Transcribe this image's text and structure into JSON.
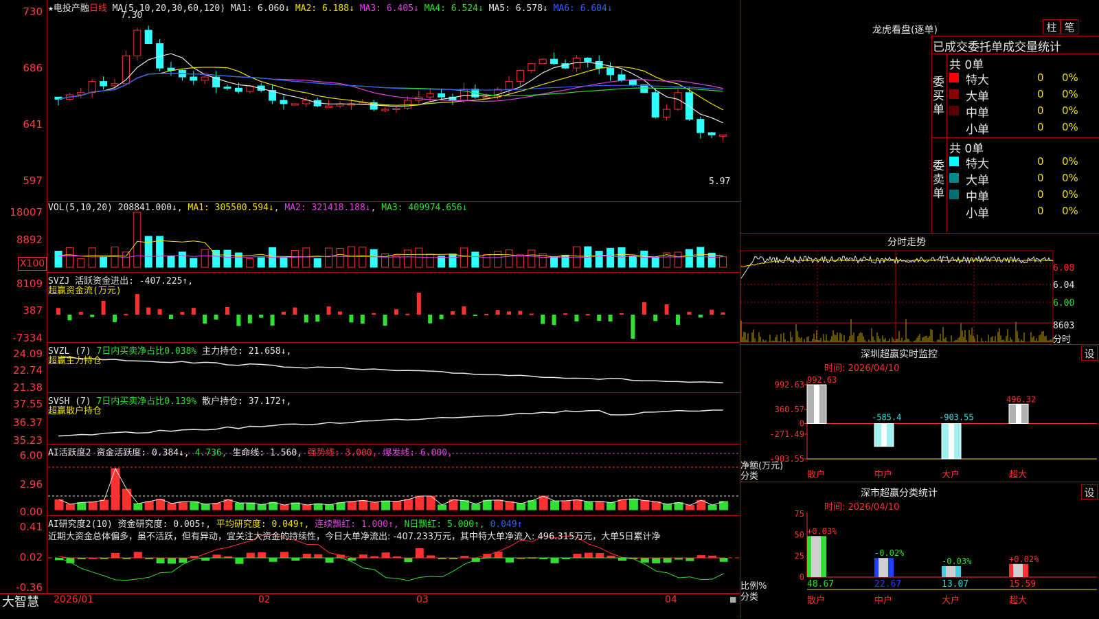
{
  "app": {
    "brand": "大智慧"
  },
  "kline": {
    "title": "★电投产融",
    "period": "日线",
    "ma_params": "MA(5,10,20,30,60,120)",
    "ma": [
      {
        "name": "MA1",
        "value": "6.060↓",
        "color": "#e6e6e6"
      },
      {
        "name": "MA2",
        "value": "6.188↓",
        "color": "#f0e000"
      },
      {
        "name": "MA3",
        "value": "6.405↓",
        "color": "#e040e0"
      },
      {
        "name": "MA4",
        "value": "6.524↓",
        "color": "#30e030"
      },
      {
        "name": "MA5",
        "value": "6.578↓",
        "color": "#e6e6e6"
      },
      {
        "name": "MA6",
        "value": "6.604↓",
        "color": "#3060ff"
      }
    ],
    "y_ticks": [
      "730",
      "686",
      "641",
      "597"
    ],
    "high_label": "7.30",
    "low_label": "5.97"
  },
  "vol": {
    "header": "VOL(5,10,20)",
    "value": "208841.000↓",
    "ma1": "MA1: 305500.594↓",
    "ma2": "MA2: 321418.188↓",
    "ma3": "MA3: 409974.656↓",
    "y_ticks": [
      "18007",
      "8892"
    ],
    "unit": "X100"
  },
  "svzj": {
    "header": "SVZJ",
    "item": "活跃资金进出: -407.225↑,",
    "subtitle": "超赢资金流(万元)",
    "y_ticks": [
      "8109",
      "387",
      "-7334"
    ]
  },
  "svzl": {
    "header": "SVZL (7)",
    "item1": "7日内买卖净占比0.038%",
    "item2": "主力持仓: 21.658↓,",
    "subtitle": "超赢主力持仓",
    "y_ticks": [
      "24.09",
      "22.74",
      "21.38"
    ]
  },
  "svsh": {
    "header": "SVSH (7)",
    "item1": "7日内买卖净占比0.139%",
    "item2": "散户持仓: 37.172↑,",
    "subtitle": "超赢散户持仓",
    "y_ticks": [
      "37.55",
      "36.37",
      "35.23"
    ]
  },
  "ai1": {
    "header": "AI活跃度2",
    "item1": "资金活跃度: 0.384↓,",
    "item2": "4.736,",
    "item3": "生命线: 1.560,",
    "item4": "强势线: 3.000,",
    "item5": "爆发线: 6.000,",
    "y_ticks": [
      "6.00",
      "2.96",
      "0.00"
    ]
  },
  "ai2": {
    "header": "AI研究度2(10)",
    "item1": "资金研究度: 0.005↑,",
    "item2": "平均研究度: 0.049↑,",
    "item3": "连续飘红: 1.000↑,",
    "item4": "N日飘红: 5.000↑,",
    "item5": "0.049↑",
    "comment": "近期大资金总体偏多，虽不活跃，但有异动，宜关注大资金的持续性，今日大单净流出: -407.233万元，其中特大单净流入: 496.315万元，大单5日累计净",
    "y_ticks": [
      "0.41",
      "0.02",
      "-0.36"
    ]
  },
  "xaxis": {
    "labels": [
      "2026/01",
      "02",
      "03",
      "04"
    ]
  },
  "lhb": {
    "title": "龙虎看盘(逐单)",
    "tab1": "柱",
    "tab2": "笔",
    "subtitle": "已成交委托单成交量统计",
    "buy": {
      "side": "委买单",
      "total": "共 0单",
      "rows": [
        {
          "label": "特大",
          "value": "0",
          "pct": "0%",
          "color": "#ff0000"
        },
        {
          "label": "大单",
          "value": "0",
          "pct": "0%",
          "color": "#8b0000"
        },
        {
          "label": "中单",
          "value": "0",
          "pct": "0%",
          "color": "#5a0000"
        },
        {
          "label": "小单",
          "value": "0",
          "pct": "0%",
          "color": "#000000"
        }
      ]
    },
    "sell": {
      "side": "委卖单",
      "total": "共 0单",
      "rows": [
        {
          "label": "特大",
          "value": "0",
          "pct": "0%",
          "color": "#00ffff"
        },
        {
          "label": "大单",
          "value": "0",
          "pct": "0%",
          "color": "#008b8b"
        },
        {
          "label": "中单",
          "value": "0",
          "pct": "0%",
          "color": "#007070"
        },
        {
          "label": "小单",
          "value": "0",
          "pct": "0%",
          "color": "#000000"
        }
      ]
    }
  },
  "intraday": {
    "title": "分时走势",
    "y_ticks": [
      "6.08",
      "6.04",
      "6.00"
    ],
    "vol_tick": "8603",
    "vol_label": "分时"
  },
  "sz_monitor": {
    "title": "深圳超赢实时监控",
    "settings": "设",
    "time": "时间: 2026/04/10",
    "y_ticks": [
      "992.63",
      "360.57",
      "0",
      "-271.49",
      "-903.55"
    ],
    "ylabel1": "净额(万元)",
    "ylabel2": "分类",
    "chart_data": {
      "type": "bar",
      "categories": [
        "散户",
        "中户",
        "大户",
        "超大"
      ],
      "values": [
        992.63,
        -585.4,
        -903.55,
        496.32
      ],
      "labels": [
        "992.63",
        "-585.4",
        "-903.55",
        "496.32"
      ],
      "ylim": [
        -903.55,
        992.63
      ]
    }
  },
  "sz_class": {
    "title": "深市超赢分类统计",
    "settings": "设",
    "time": "时间: 2026/04/10",
    "y_ticks": [
      "75",
      "50",
      "25",
      "0"
    ],
    "ylabel1": "比例%",
    "ylabel2": "分类",
    "chart_data": {
      "type": "bar",
      "categories": [
        "散户",
        "中户",
        "大户",
        "超大"
      ],
      "values": [
        48.67,
        22.67,
        13.07,
        15.59
      ],
      "changes": [
        "+0.03%",
        "-0.02%",
        "-0.03%",
        "+0.02%"
      ],
      "labels": [
        "48.67",
        "22.67",
        "13.07",
        "15.59"
      ],
      "ylim": [
        0,
        75
      ]
    }
  }
}
